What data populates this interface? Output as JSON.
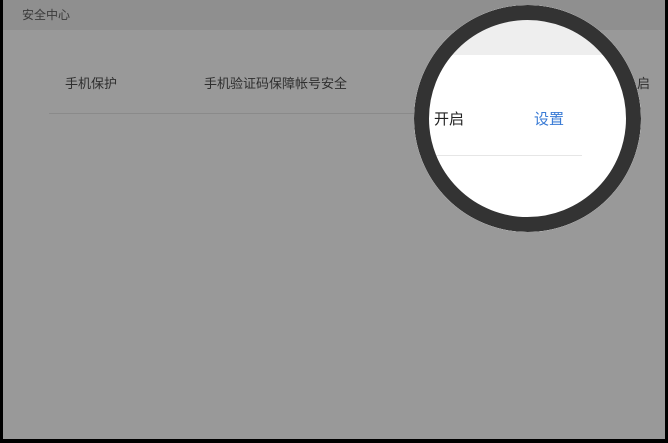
{
  "header": {
    "title": "安全中心"
  },
  "security_row": {
    "label": "手机保护",
    "description": "手机验证码保障帐号安全",
    "status_edge": "启"
  },
  "magnifier": {
    "status": "开启",
    "setting_link": "设置"
  },
  "colors": {
    "overlay": "#999999",
    "link": "#3a7bd5",
    "ring": "#333333"
  }
}
